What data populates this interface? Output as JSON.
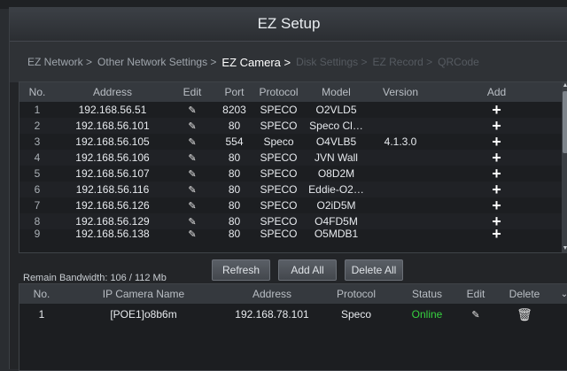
{
  "window": {
    "title": "EZ Setup"
  },
  "breadcrumb": [
    {
      "label": "EZ Network >",
      "state": "done"
    },
    {
      "label": "Other Network Settings >",
      "state": "done"
    },
    {
      "label": "EZ Camera >",
      "state": "active"
    },
    {
      "label": "Disk Settings >",
      "state": "disabled"
    },
    {
      "label": "EZ Record >",
      "state": "disabled"
    },
    {
      "label": "QRCode",
      "state": "disabled"
    }
  ],
  "camera_table": {
    "headers": {
      "no": "No.",
      "address": "Address",
      "edit": "Edit",
      "port": "Port",
      "protocol": "Protocol",
      "model": "Model",
      "version": "Version",
      "add": "Add"
    },
    "rows": [
      {
        "no": "1",
        "address": "192.168.56.51",
        "port": "8203",
        "protocol": "SPECO",
        "model": "O2VLD5",
        "version": ""
      },
      {
        "no": "2",
        "address": "192.168.56.101",
        "port": "80",
        "protocol": "SPECO",
        "model": "Speco Cl…",
        "version": ""
      },
      {
        "no": "3",
        "address": "192.168.56.105",
        "port": "554",
        "protocol": "Speco",
        "model": "O4VLB5",
        "version": "4.1.3.0"
      },
      {
        "no": "4",
        "address": "192.168.56.106",
        "port": "80",
        "protocol": "SPECO",
        "model": "JVN Wall",
        "version": ""
      },
      {
        "no": "5",
        "address": "192.168.56.107",
        "port": "80",
        "protocol": "SPECO",
        "model": "O8D2M",
        "version": ""
      },
      {
        "no": "6",
        "address": "192.168.56.116",
        "port": "80",
        "protocol": "SPECO",
        "model": "Eddie-O2…",
        "version": ""
      },
      {
        "no": "7",
        "address": "192.168.56.126",
        "port": "80",
        "protocol": "SPECO",
        "model": "O2iD5M",
        "version": ""
      },
      {
        "no": "8",
        "address": "192.168.56.129",
        "port": "80",
        "protocol": "SPECO",
        "model": "O4FD5M",
        "version": ""
      },
      {
        "no": "9",
        "address": "192.168.56.138",
        "port": "80",
        "protocol": "SPECO",
        "model": "O5MDB1",
        "version": ""
      }
    ]
  },
  "bandwidth": {
    "text": "Remain Bandwidth: 106 / 112 Mb"
  },
  "buttons": {
    "refresh": "Refresh",
    "add_all": "Add All",
    "delete_all": "Delete All"
  },
  "added_list": {
    "headers": {
      "no": "No.",
      "name": "IP Camera Name",
      "address": "Address",
      "protocol": "Protocol",
      "status": "Status",
      "edit": "Edit",
      "delete": "Delete"
    },
    "rows": [
      {
        "no": "1",
        "name": "[POE1]o8b6m",
        "address": "192.168.78.101",
        "protocol": "Speco",
        "status": "Online"
      }
    ]
  },
  "colors": {
    "online": "#36d13f",
    "active_crumb": "#ffffff",
    "disabled_crumb": "#555a60"
  },
  "icons": {
    "edit": "pencil-icon",
    "add": "plus-icon",
    "delete": "trash-icon",
    "expand": "chevron-down-icon"
  }
}
